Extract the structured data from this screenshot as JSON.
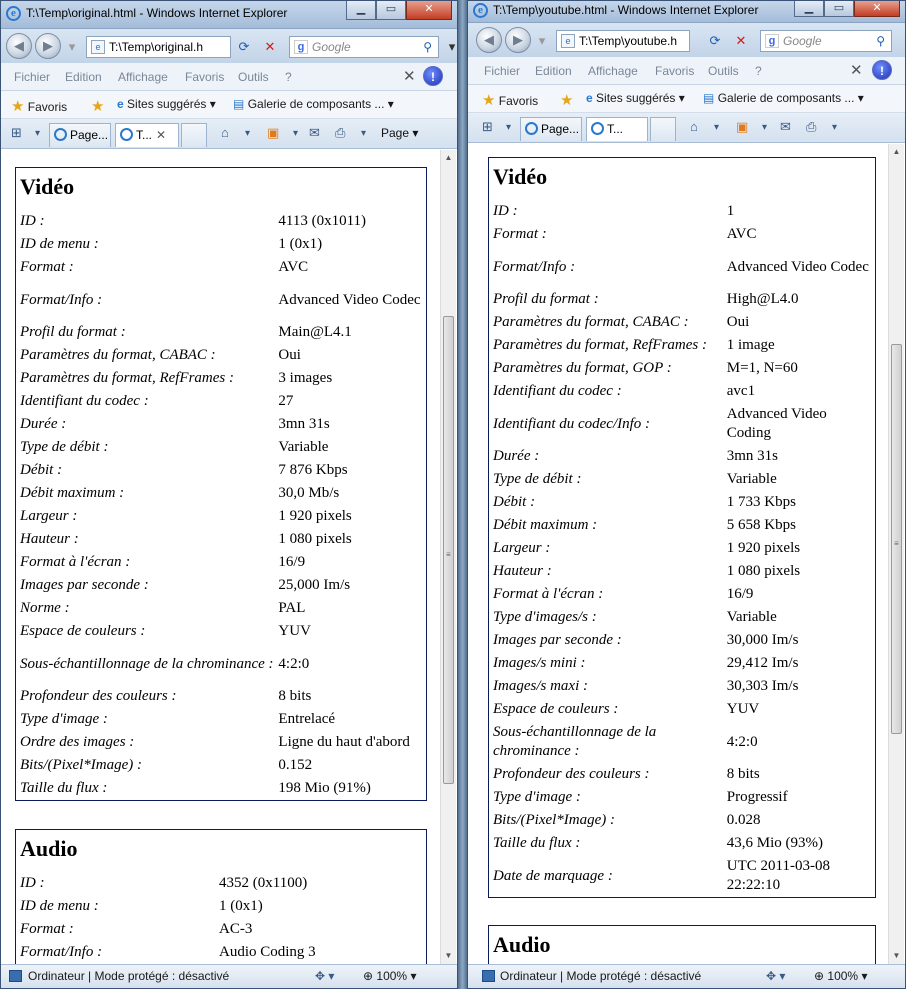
{
  "left": {
    "window_title": "T:\\Temp\\original.html - Windows Internet Explorer",
    "address": "T:\\Temp\\original.h",
    "search_placeholder": "Google",
    "menu": [
      "Fichier",
      "Edition",
      "Affichage",
      "Favoris",
      "Outils",
      "?"
    ],
    "favorites": {
      "label": "Favoris",
      "suggested": "Sites suggérés ▾",
      "gallery": "Galerie de composants ... ▾"
    },
    "tabs": [
      {
        "label": "Page..."
      },
      {
        "label": "T..."
      }
    ],
    "page_menu": "Page ▾",
    "sections": [
      {
        "title": "Vidéo",
        "rows": [
          {
            "label": "ID :",
            "value": "4113 (0x1011)"
          },
          {
            "label": "ID de menu :",
            "value": "1 (0x1)"
          },
          {
            "label": "Format :",
            "value": "AVC"
          },
          {
            "label": "Format/Info :",
            "value": "Advanced Video Codec"
          },
          {
            "label": "Profil du format :",
            "value": "Main@L4.1"
          },
          {
            "label": "Paramètres du format, CABAC :",
            "value": "Oui"
          },
          {
            "label": "Paramètres du format, RefFrames :",
            "value": "3 images"
          },
          {
            "label": "Identifiant du codec :",
            "value": "27"
          },
          {
            "label": "Durée :",
            "value": "3mn 31s"
          },
          {
            "label": "Type de débit :",
            "value": "Variable"
          },
          {
            "label": "Débit :",
            "value": "7 876 Kbps"
          },
          {
            "label": "Débit maximum :",
            "value": "30,0 Mb/s"
          },
          {
            "label": "Largeur :",
            "value": "1 920 pixels"
          },
          {
            "label": "Hauteur :",
            "value": "1 080 pixels"
          },
          {
            "label": "Format à l'écran :",
            "value": "16/9"
          },
          {
            "label": "Images par seconde :",
            "value": "25,000 Im/s"
          },
          {
            "label": "Norme :",
            "value": "PAL"
          },
          {
            "label": "Espace de couleurs :",
            "value": "YUV"
          },
          {
            "label": "Sous-échantillonnage de la chrominance :",
            "value": "4:2:0"
          },
          {
            "label": "Profondeur des couleurs :",
            "value": "8 bits"
          },
          {
            "label": "Type d'image :",
            "value": "Entrelacé"
          },
          {
            "label": "Ordre des images :",
            "value": "Ligne du haut d'abord"
          },
          {
            "label": "Bits/(Pixel*Image) :",
            "value": "0.152"
          },
          {
            "label": "Taille du flux :",
            "value": "198 Mio (91%)"
          }
        ]
      },
      {
        "title": "Audio",
        "rows": [
          {
            "label": "ID :",
            "value": "4352 (0x1100)"
          },
          {
            "label": "ID de menu :",
            "value": "1 (0x1)"
          },
          {
            "label": "Format :",
            "value": "AC-3"
          },
          {
            "label": "Format/Info :",
            "value": "Audio Coding 3"
          }
        ]
      }
    ],
    "status": {
      "zone": "Ordinateur | Mode protégé : désactivé",
      "zoom": "100%"
    }
  },
  "right": {
    "window_title": "T:\\Temp\\youtube.html - Windows Internet Explorer",
    "address": "T:\\Temp\\youtube.h",
    "search_placeholder": "Google",
    "menu": [
      "Fichier",
      "Edition",
      "Affichage",
      "Favoris",
      "Outils",
      "?"
    ],
    "favorites": {
      "label": "Favoris",
      "suggested": "Sites suggérés ▾",
      "gallery": "Galerie de composants ... ▾"
    },
    "tabs": [
      {
        "label": "Page..."
      },
      {
        "label": "T..."
      }
    ],
    "sections": [
      {
        "title": "Vidéo",
        "rows": [
          {
            "label": "ID :",
            "value": "1"
          },
          {
            "label": "Format :",
            "value": "AVC"
          },
          {
            "label": "Format/Info :",
            "value": "Advanced Video Codec"
          },
          {
            "label": "Profil du format :",
            "value": "High@L4.0"
          },
          {
            "label": "Paramètres du format, CABAC :",
            "value": "Oui"
          },
          {
            "label": "Paramètres du format, RefFrames :",
            "value": "1 image"
          },
          {
            "label": "Paramètres du format, GOP :",
            "value": "M=1, N=60"
          },
          {
            "label": "Identifiant du codec :",
            "value": "avc1"
          },
          {
            "label": "Identifiant du codec/Info :",
            "value": "Advanced Video Coding"
          },
          {
            "label": "Durée :",
            "value": "3mn 31s"
          },
          {
            "label": "Type de débit :",
            "value": "Variable"
          },
          {
            "label": "Débit :",
            "value": "1 733 Kbps"
          },
          {
            "label": "Débit maximum :",
            "value": "5 658 Kbps"
          },
          {
            "label": "Largeur :",
            "value": "1 920 pixels"
          },
          {
            "label": "Hauteur :",
            "value": "1 080 pixels"
          },
          {
            "label": "Format à l'écran :",
            "value": "16/9"
          },
          {
            "label": "Type d'images/s :",
            "value": "Variable"
          },
          {
            "label": "Images par seconde :",
            "value": "30,000 Im/s"
          },
          {
            "label": "Images/s mini :",
            "value": "29,412 Im/s"
          },
          {
            "label": "Images/s maxi :",
            "value": "30,303 Im/s"
          },
          {
            "label": "Espace de couleurs :",
            "value": "YUV"
          },
          {
            "label": "Sous-échantillonnage de la chrominance :",
            "value": "4:2:0"
          },
          {
            "label": "Profondeur des couleurs :",
            "value": "8 bits"
          },
          {
            "label": "Type d'image :",
            "value": "Progressif"
          },
          {
            "label": "Bits/(Pixel*Image) :",
            "value": "0.028"
          },
          {
            "label": "Taille du flux :",
            "value": "43,6 Mio (93%)"
          },
          {
            "label": "Date de marquage :",
            "value": "UTC 2011-03-08 22:22:10"
          }
        ]
      },
      {
        "title": "Audio",
        "rows": []
      }
    ],
    "status": {
      "zone": "Ordinateur | Mode protégé : désactivé",
      "zoom": "100%"
    }
  }
}
